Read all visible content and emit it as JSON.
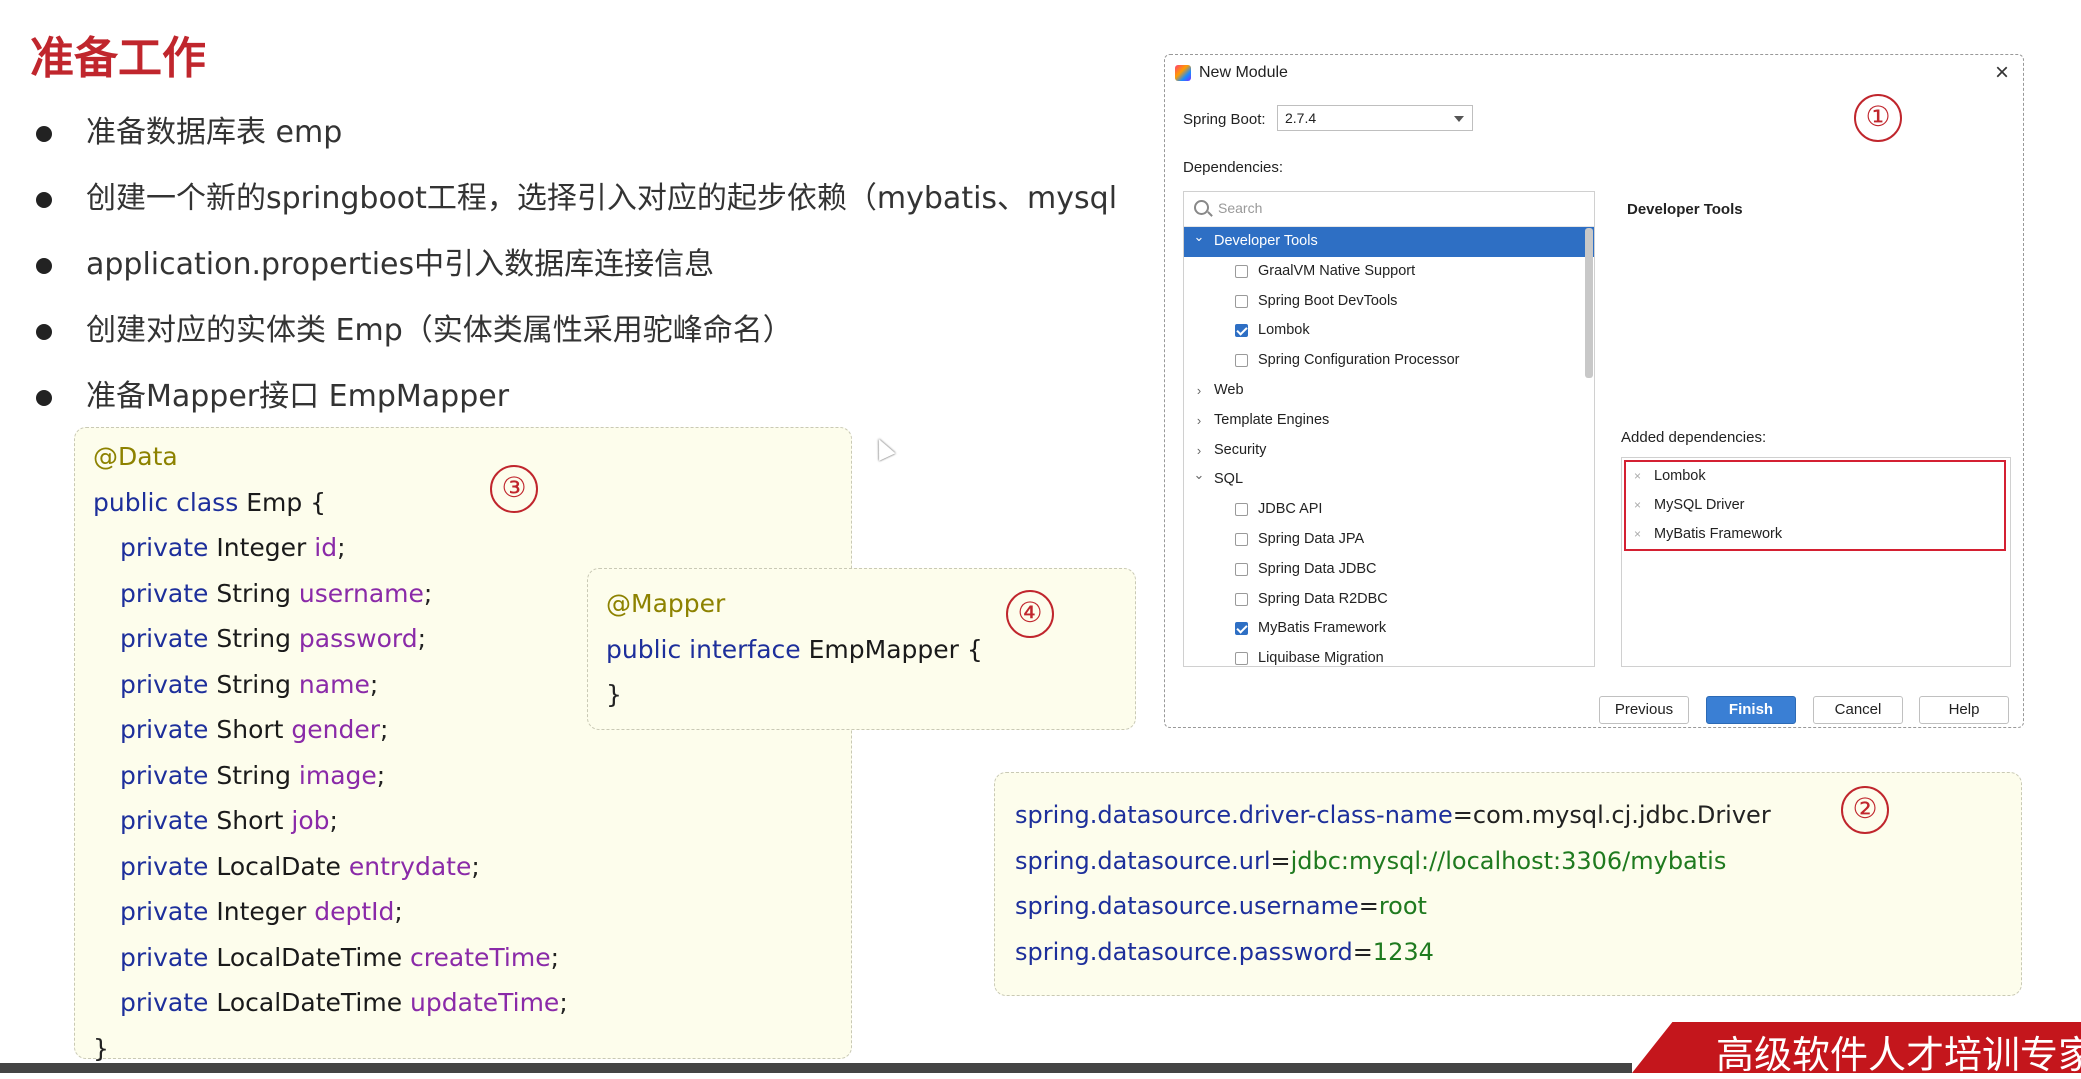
{
  "slide": {
    "title": "准备工作",
    "bullets": [
      "准备数据库表 emp",
      "创建一个新的springboot工程，选择引入对应的起步依赖（mybatis、mysql",
      "application.properties中引入数据库连接信息",
      "创建对应的实体类 Emp（实体类属性采用驼峰命名）",
      "准备Mapper接口 EmpMapper"
    ],
    "markers": [
      "①",
      "②",
      "③",
      "④"
    ]
  },
  "emp_code": {
    "annotation": "@Data",
    "decl_kw": "public class",
    "decl_name": "Emp {",
    "fields": [
      {
        "mod": "private",
        "type": "Integer",
        "name": "id"
      },
      {
        "mod": "private",
        "type": "String",
        "name": "username"
      },
      {
        "mod": "private",
        "type": "String",
        "name": "password"
      },
      {
        "mod": "private",
        "type": "String",
        "name": "name"
      },
      {
        "mod": "private",
        "type": "Short",
        "name": "gender"
      },
      {
        "mod": "private",
        "type": "String",
        "name": "image"
      },
      {
        "mod": "private",
        "type": "Short",
        "name": "job"
      },
      {
        "mod": "private",
        "type": "LocalDate",
        "name": "entrydate"
      },
      {
        "mod": "private",
        "type": "Integer",
        "name": "deptId"
      },
      {
        "mod": "private",
        "type": "LocalDateTime",
        "name": "createTime"
      },
      {
        "mod": "private",
        "type": "LocalDateTime",
        "name": "updateTime"
      }
    ],
    "close": "}"
  },
  "mapper_code": {
    "annotation": "@Mapper",
    "decl_kw": "public interface",
    "decl_name": "EmpMapper {",
    "close": "}"
  },
  "properties": [
    {
      "key": "spring.datasource.driver-class-name",
      "eq": "=",
      "value": "com.mysql.cj.jdbc.Driver",
      "value_style": "plain"
    },
    {
      "key": "spring.datasource.url",
      "eq": "=",
      "value": "jdbc:mysql://localhost:3306/mybatis",
      "value_style": "green"
    },
    {
      "key": "spring.datasource.username",
      "eq": "=",
      "value": "root",
      "value_style": "green"
    },
    {
      "key": "spring.datasource.password",
      "eq": "=",
      "value": "1234",
      "value_style": "green"
    }
  ],
  "dialog": {
    "title": "New Module",
    "close": "×",
    "spring_boot_label": "Spring Boot:",
    "spring_boot_value": "2.7.4",
    "dependencies_label": "Dependencies:",
    "search_placeholder": "Search",
    "tree": [
      {
        "kind": "category",
        "label": "Developer Tools",
        "expanded": true,
        "selected": true
      },
      {
        "kind": "item",
        "label": "GraalVM Native Support",
        "checked": false
      },
      {
        "kind": "item",
        "label": "Spring Boot DevTools",
        "checked": false
      },
      {
        "kind": "item",
        "label": "Lombok",
        "checked": true
      },
      {
        "kind": "item",
        "label": "Spring Configuration Processor",
        "checked": false
      },
      {
        "kind": "category",
        "label": "Web",
        "expanded": false
      },
      {
        "kind": "category",
        "label": "Template Engines",
        "expanded": false
      },
      {
        "kind": "category",
        "label": "Security",
        "expanded": false
      },
      {
        "kind": "category",
        "label": "SQL",
        "expanded": true
      },
      {
        "kind": "item",
        "label": "JDBC API",
        "checked": false
      },
      {
        "kind": "item",
        "label": "Spring Data JPA",
        "checked": false
      },
      {
        "kind": "item",
        "label": "Spring Data JDBC",
        "checked": false
      },
      {
        "kind": "item",
        "label": "Spring Data R2DBC",
        "checked": false
      },
      {
        "kind": "item",
        "label": "MyBatis Framework",
        "checked": true
      },
      {
        "kind": "item",
        "label": "Liquibase Migration",
        "checked": false
      }
    ],
    "detail_title": "Developer Tools",
    "added_label": "Added dependencies:",
    "added": [
      "Lombok",
      "MySQL Driver",
      "MyBatis Framework"
    ],
    "remove_glyph": "×",
    "buttons": {
      "previous": "Previous",
      "finish": "Finish",
      "cancel": "Cancel",
      "help": "Help"
    }
  },
  "banner_text": "高级软件人才培训专家",
  "colors": {
    "accent_red": "#c0262d",
    "keyword_blue": "#1d2f9b",
    "field_purple": "#8a2aa8",
    "annotation_olive": "#8d8200",
    "selection_blue": "#2e6fc4"
  }
}
